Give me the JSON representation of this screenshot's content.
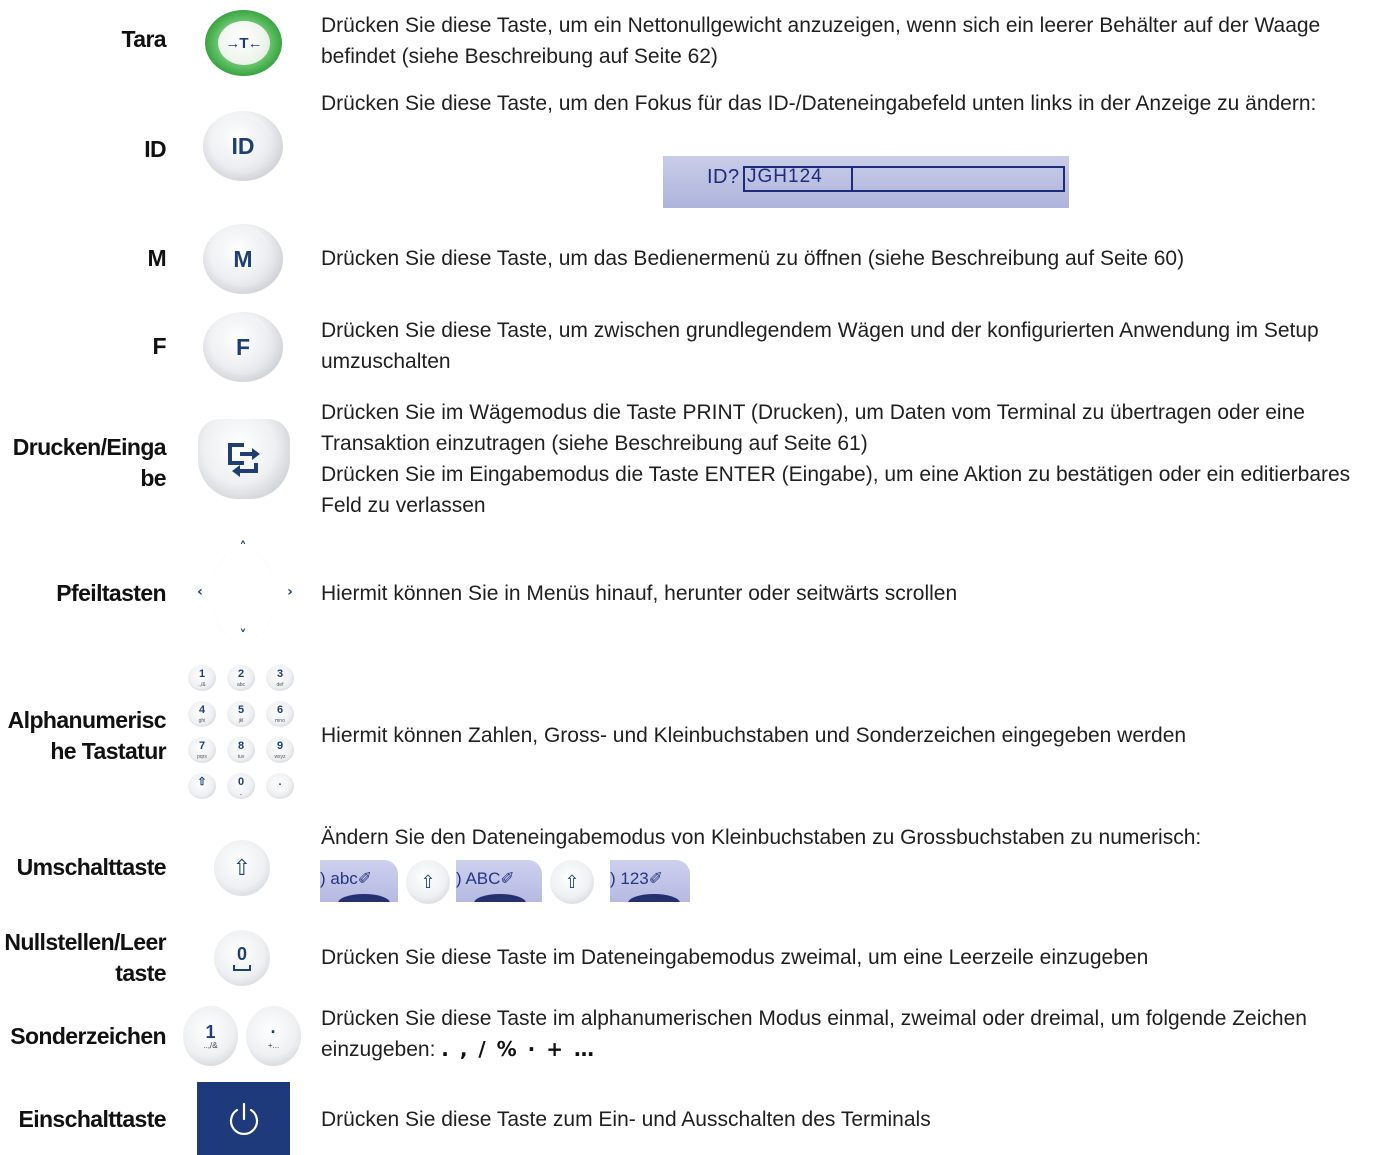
{
  "rows": {
    "tara": {
      "label": "Tara",
      "key_text": "→T←",
      "desc": "Drücken Sie diese Taste, um ein Nettonullgewicht anzuzeigen, wenn sich ein leerer Behälter auf der Waage befindet (siehe Beschreibung auf Seite 62)",
      "key_color": "#2f9e38"
    },
    "id": {
      "label": "ID",
      "key_text": "ID",
      "desc": "Drücken Sie diese Taste, um den Fokus für das ID-/Dateneingabefeld unten links in der Anzeige zu ändern:",
      "field_prompt": "ID?",
      "field_value": "JGH124"
    },
    "m": {
      "label": "M",
      "key_text": "M",
      "desc": "Drücken Sie diese Taste, um das Bedienermenü zu öffnen (siehe Beschreibung auf Seite 60)"
    },
    "f": {
      "label": "F",
      "key_text": "F",
      "desc": "Drücken Sie diese Taste, um zwischen grundlegendem Wägen und der konfigurierten Anwendung im Setup umzuschalten"
    },
    "print": {
      "label_line1": "Drucken/Einga",
      "label_line2": "be",
      "desc_print": "Drücken Sie im Wägemodus die Taste PRINT (Drucken), um Daten vom Terminal zu übertragen oder eine Transaktion einzutragen (siehe Beschreibung auf Seite 61)",
      "desc_enter": "Drücken Sie im Eingabemodus die Taste ENTER (Eingabe), um eine Aktion zu bestätigen oder ein editierbares Feld zu verlassen"
    },
    "arrows": {
      "label": "Pfeiltasten",
      "desc": "Hiermit können Sie in Menüs hinauf, herunter oder seitwärts scrollen"
    },
    "alnum": {
      "label_line1": "Alphanumerisc",
      "label_line2": "he Tastatur",
      "desc": "Hiermit können Zahlen, Gross- und Kleinbuchstaben und Sonderzeichen eingegeben werden",
      "keys": [
        {
          "n": "1",
          "s": ".,/&"
        },
        {
          "n": "2",
          "s": "abc"
        },
        {
          "n": "3",
          "s": "def"
        },
        {
          "n": "4",
          "s": "ghi"
        },
        {
          "n": "5",
          "s": "jkl"
        },
        {
          "n": "6",
          "s": "mno"
        },
        {
          "n": "7",
          "s": "pqrs"
        },
        {
          "n": "8",
          "s": "tuv"
        },
        {
          "n": "9",
          "s": "wxyz"
        },
        {
          "n": "⇧",
          "s": ""
        },
        {
          "n": "0",
          "s": "⎵"
        },
        {
          "n": ".",
          "s": ""
        }
      ]
    },
    "shift": {
      "label": "Umschalttaste",
      "desc": "Ändern Sie den Dateneingabemodus von Kleinbuchstaben zu Grossbuchstaben zu numerisch:",
      "key_text": "⇧",
      "modes": [
        ") abc✐",
        ") ABC✐",
        ") 123✐"
      ]
    },
    "zero": {
      "label_line1": "Nullstellen/Leer",
      "label_line2": "taste",
      "key_text": "0",
      "desc": "Drücken Sie diese Taste im Dateneingabemodus zweimal, um eine Leerzeile einzugeben"
    },
    "special": {
      "label": "Sonderzeichen",
      "key1_text": "1",
      "key1_sub": "..,/&",
      "key2_text": "·",
      "key2_sub": "+...",
      "desc": "Drücken Sie diese Taste im alphanumerischen Modus einmal, zweimal oder dreimal, um folgende Zeichen einzugeben:",
      "symbols": ". ,  /  %  ·  +  …"
    },
    "power": {
      "label": "Einschalttaste",
      "desc": "Drücken Sie diese Taste zum Ein- und Ausschalten des Terminals",
      "key_color": "#1f3a7a"
    }
  }
}
